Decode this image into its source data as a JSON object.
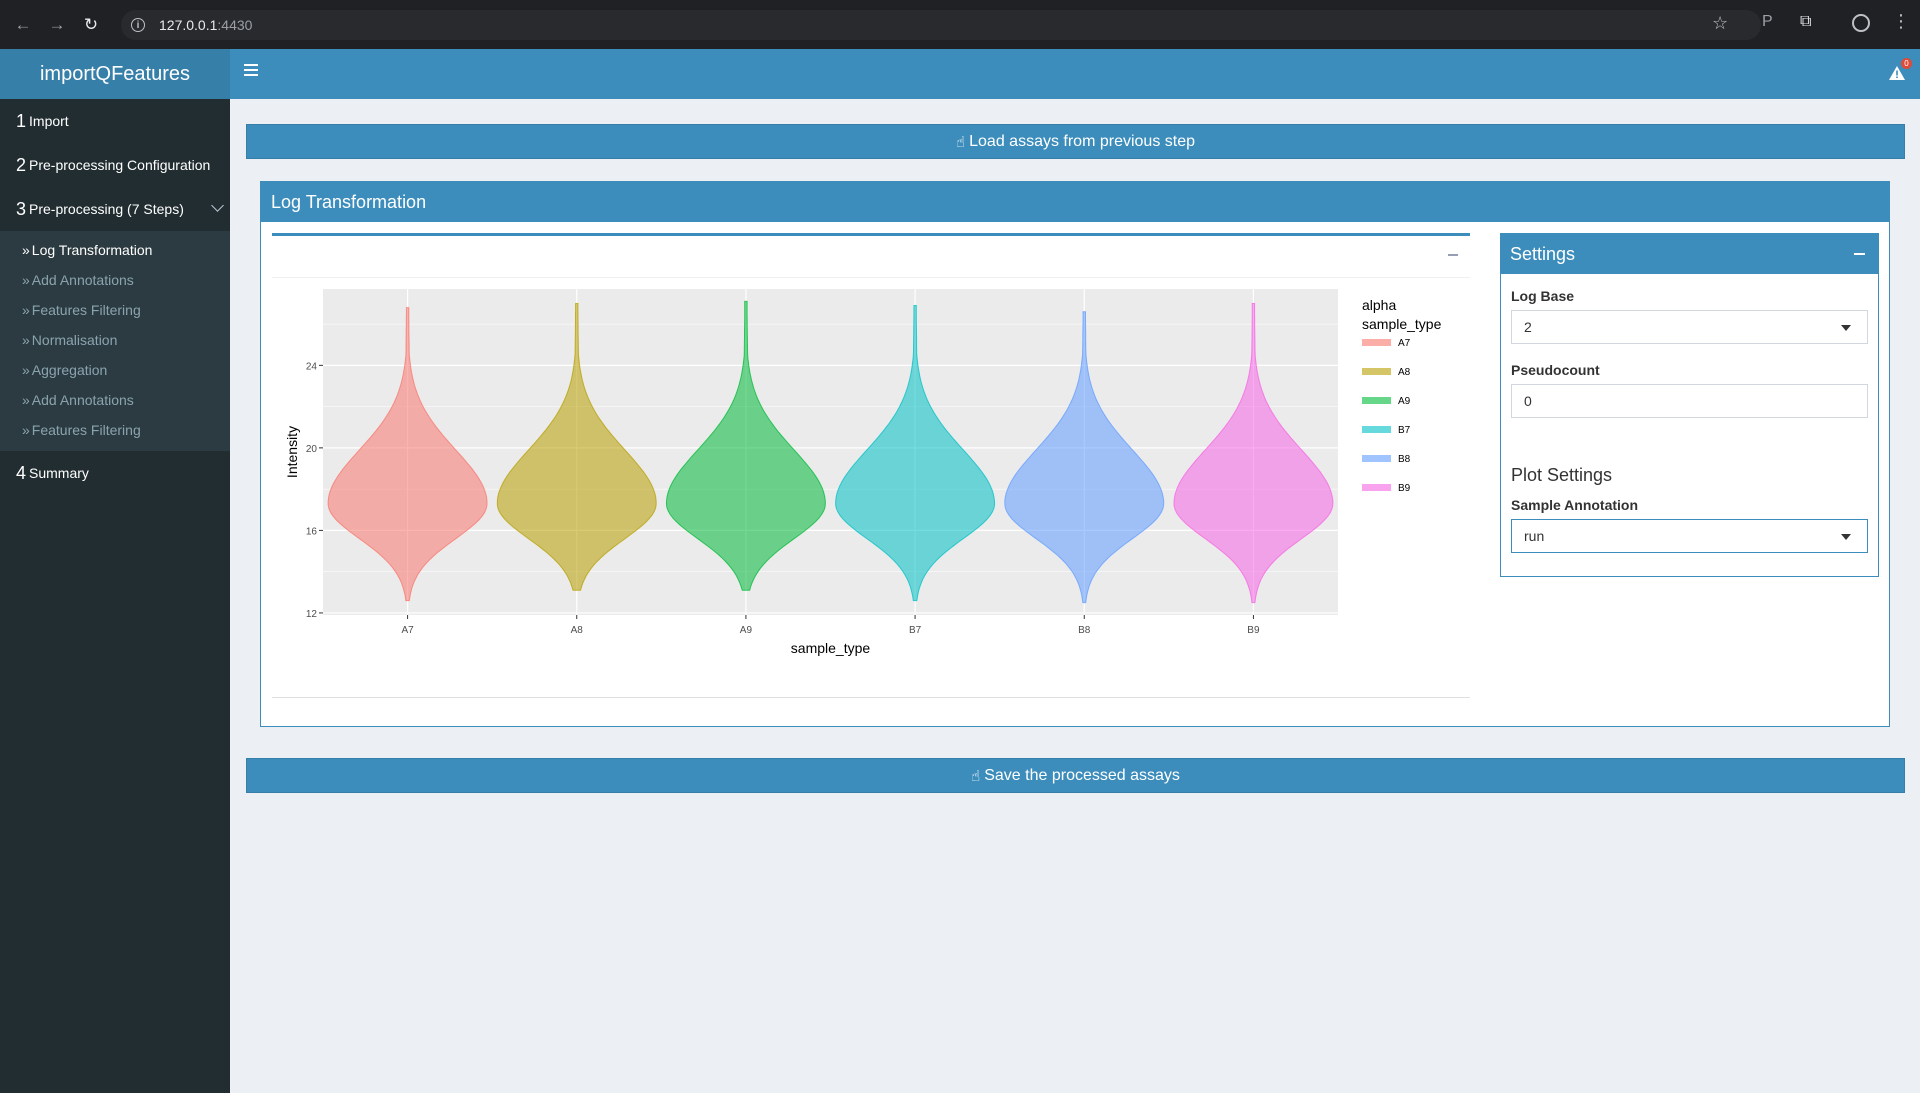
{
  "browser": {
    "url_host": "127.0.0.1",
    "url_port": ":4430"
  },
  "app": {
    "title": "importQFeatures",
    "alert_count": "0"
  },
  "sidebar": {
    "items": [
      {
        "num": "1",
        "label": "Import"
      },
      {
        "num": "2",
        "label": "Pre-processing Configuration"
      },
      {
        "num": "3",
        "label": "Pre-processing (7 Steps)"
      },
      {
        "num": "4",
        "label": "Summary"
      }
    ],
    "subitems": [
      {
        "label": "Log Transformation",
        "active": true
      },
      {
        "label": "Add Annotations",
        "active": false
      },
      {
        "label": "Features Filtering",
        "active": false
      },
      {
        "label": "Normalisation",
        "active": false
      },
      {
        "label": "Aggregation",
        "active": false
      },
      {
        "label": "Add Annotations",
        "active": false
      },
      {
        "label": "Features Filtering",
        "active": false
      }
    ]
  },
  "main": {
    "load_button": "Load assays from previous step",
    "save_button": "Save the processed assays",
    "box_title": "Log Transformation"
  },
  "settings": {
    "title": "Settings",
    "log_base_label": "Log Base",
    "log_base_value": "2",
    "pseudocount_label": "Pseudocount",
    "pseudocount_value": "0",
    "plot_settings_title": "Plot Settings",
    "sample_annotation_label": "Sample Annotation",
    "sample_annotation_value": "run"
  },
  "chart_data": {
    "type": "violin",
    "xlabel": "sample_type",
    "ylabel": "Intensity",
    "categories": [
      "A7",
      "A8",
      "A9",
      "B7",
      "B8",
      "B9"
    ],
    "y_ticks": [
      12,
      16,
      20,
      24
    ],
    "ylim": [
      11.9,
      27.7
    ],
    "legend_title_line1": "alpha",
    "legend_title_line2": "sample_type",
    "legend_position": "right",
    "grid": true,
    "series": [
      {
        "name": "A7",
        "color": "#F8766D",
        "min": 12.6,
        "max": 26.8,
        "mode": 17.3
      },
      {
        "name": "A8",
        "color": "#B79F00",
        "min": 13.1,
        "max": 27.0,
        "mode": 17.3
      },
      {
        "name": "A9",
        "color": "#00BA38",
        "min": 13.1,
        "max": 27.1,
        "mode": 17.3
      },
      {
        "name": "B7",
        "color": "#00BFC4",
        "min": 12.6,
        "max": 26.9,
        "mode": 17.3
      },
      {
        "name": "B8",
        "color": "#619CFF",
        "min": 12.5,
        "max": 26.6,
        "mode": 17.3
      },
      {
        "name": "B9",
        "color": "#F564E3",
        "min": 12.5,
        "max": 27.0,
        "mode": 17.3
      }
    ]
  }
}
